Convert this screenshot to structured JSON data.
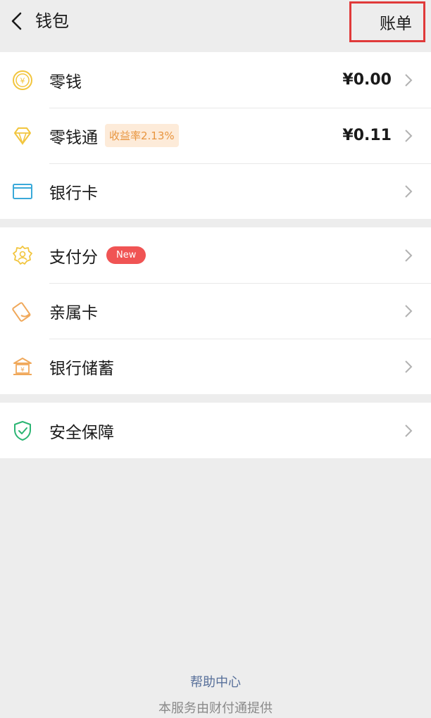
{
  "header": {
    "title": "钱包",
    "bill_label": "账单"
  },
  "groups": [
    {
      "items": [
        {
          "label": "零钱",
          "amount": "¥0.00",
          "icon": "coin-yen-icon",
          "color": "#f2c53d"
        },
        {
          "label": "零钱通",
          "tag": "收益率2.13%",
          "amount": "¥0.11",
          "icon": "diamond-icon",
          "color": "#f2c53d"
        },
        {
          "label": "银行卡",
          "icon": "bank-card-icon",
          "color": "#3aa9d9"
        }
      ]
    },
    {
      "items": [
        {
          "label": "支付分",
          "badge": "New",
          "icon": "badge-score-icon",
          "color": "#f2c53d"
        },
        {
          "label": "亲属卡",
          "icon": "family-card-icon",
          "color": "#f0a85a"
        },
        {
          "label": "银行储蓄",
          "icon": "bank-savings-icon",
          "color": "#f0a85a"
        }
      ]
    },
    {
      "items": [
        {
          "label": "安全保障",
          "icon": "shield-check-icon",
          "color": "#2bb573"
        }
      ]
    }
  ],
  "footer": {
    "help_link": "帮助中心",
    "provider_note": "本服务由财付通提供"
  }
}
